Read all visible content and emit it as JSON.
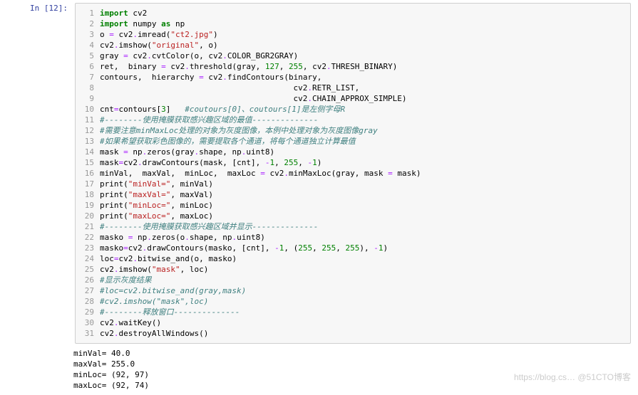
{
  "cell": {
    "prompt": "In [12]:",
    "lines": [
      {
        "n": "1",
        "html": "<span class='kw'>import</span> <span class='nam'>cv2</span>"
      },
      {
        "n": "2",
        "html": "<span class='kw'>import</span> <span class='nam'>numpy</span> <span class='kw'>as</span> <span class='nam'>np</span>"
      },
      {
        "n": "3",
        "html": "<span class='nam'>o</span> <span class='op'>=</span> <span class='nam'>cv2</span><span class='op'>.</span><span class='nam'>imread</span>(<span class='str'>\"ct2.jpg\"</span>)"
      },
      {
        "n": "4",
        "html": "<span class='nam'>cv2</span><span class='op'>.</span><span class='nam'>imshow</span>(<span class='str'>\"original\"</span>, <span class='nam'>o</span>)"
      },
      {
        "n": "5",
        "html": "<span class='nam'>gray</span> <span class='op'>=</span> <span class='nam'>cv2</span><span class='op'>.</span><span class='nam'>cvtColor</span>(<span class='nam'>o</span>, <span class='nam'>cv2</span><span class='op'>.</span><span class='nam'>COLOR_BGR2GRAY</span>)"
      },
      {
        "n": "6",
        "html": "<span class='nam'>ret</span>,  <span class='nam'>binary</span> <span class='op'>=</span> <span class='nam'>cv2</span><span class='op'>.</span><span class='nam'>threshold</span>(<span class='nam'>gray</span>, <span class='num'>127</span>, <span class='num'>255</span>, <span class='nam'>cv2</span><span class='op'>.</span><span class='nam'>THRESH_BINARY</span>)"
      },
      {
        "n": "7",
        "html": "<span class='nam'>contours</span>,  <span class='nam'>hierarchy</span> <span class='op'>=</span> <span class='nam'>cv2</span><span class='op'>.</span><span class='nam'>findContours</span>(<span class='nam'>binary</span>,"
      },
      {
        "n": "8",
        "html": "                                         <span class='nam'>cv2</span><span class='op'>.</span><span class='nam'>RETR_LIST</span>,"
      },
      {
        "n": "9",
        "html": "                                         <span class='nam'>cv2</span><span class='op'>.</span><span class='nam'>CHAIN_APPROX_SIMPLE</span>)"
      },
      {
        "n": "10",
        "html": "<span class='nam'>cnt</span><span class='op'>=</span><span class='nam'>contours</span>[<span class='num'>3</span>]   <span class='cmt'>#coutours[0]、coutours[1]是左侧字母R</span>"
      },
      {
        "n": "11",
        "html": "<span class='cmt'>#--------使用掩膜获取感兴趣区域的最值--------------</span>"
      },
      {
        "n": "12",
        "html": "<span class='cmt'>#需要注意minMaxLoc处理的对象为灰度图像，本例中处理对象为灰度图像gray</span>"
      },
      {
        "n": "13",
        "html": "<span class='cmt'>#如果希望获取彩色图像的，需要提取各个通道，将每个通道独立计算最值</span>"
      },
      {
        "n": "14",
        "html": "<span class='nam'>mask</span> <span class='op'>=</span> <span class='nam'>np</span><span class='op'>.</span><span class='nam'>zeros</span>(<span class='nam'>gray</span><span class='op'>.</span><span class='nam'>shape</span>, <span class='nam'>np</span><span class='op'>.</span><span class='nam'>uint8</span>)"
      },
      {
        "n": "15",
        "html": "<span class='nam'>mask</span><span class='op'>=</span><span class='nam'>cv2</span><span class='op'>.</span><span class='nam'>drawContours</span>(<span class='nam'>mask</span>, [<span class='nam'>cnt</span>], <span class='op'>-</span><span class='num'>1</span>, <span class='num'>255</span>, <span class='op'>-</span><span class='num'>1</span>)"
      },
      {
        "n": "16",
        "html": "<span class='nam'>minVal</span>,  <span class='nam'>maxVal</span>,  <span class='nam'>minLoc</span>,  <span class='nam'>maxLoc</span> <span class='op'>=</span> <span class='nam'>cv2</span><span class='op'>.</span><span class='nam'>minMaxLoc</span>(<span class='nam'>gray</span>, <span class='nam'>mask</span> <span class='op'>=</span> <span class='nam'>mask</span>)"
      },
      {
        "n": "17",
        "html": "<span class='fn'>print</span>(<span class='str'>\"minVal=\"</span>, <span class='nam'>minVal</span>)"
      },
      {
        "n": "18",
        "html": "<span class='fn'>print</span>(<span class='str'>\"maxVal=\"</span>, <span class='nam'>maxVal</span>)"
      },
      {
        "n": "19",
        "html": "<span class='fn'>print</span>(<span class='str'>\"minLoc=\"</span>, <span class='nam'>minLoc</span>)"
      },
      {
        "n": "20",
        "html": "<span class='fn'>print</span>(<span class='str'>\"maxLoc=\"</span>, <span class='nam'>maxLoc</span>)"
      },
      {
        "n": "21",
        "html": "<span class='cmt'>#--------使用掩膜获取感兴趣区域并显示--------------</span>"
      },
      {
        "n": "22",
        "html": "<span class='nam'>masko</span> <span class='op'>=</span> <span class='nam'>np</span><span class='op'>.</span><span class='nam'>zeros</span>(<span class='nam'>o</span><span class='op'>.</span><span class='nam'>shape</span>, <span class='nam'>np</span><span class='op'>.</span><span class='nam'>uint8</span>)"
      },
      {
        "n": "23",
        "html": "<span class='nam'>masko</span><span class='op'>=</span><span class='nam'>cv2</span><span class='op'>.</span><span class='nam'>drawContours</span>(<span class='nam'>masko</span>, [<span class='nam'>cnt</span>], <span class='op'>-</span><span class='num'>1</span>, (<span class='num'>255</span>, <span class='num'>255</span>, <span class='num'>255</span>), <span class='op'>-</span><span class='num'>1</span>)"
      },
      {
        "n": "24",
        "html": "<span class='nam'>loc</span><span class='op'>=</span><span class='nam'>cv2</span><span class='op'>.</span><span class='nam'>bitwise_and</span>(<span class='nam'>o</span>, <span class='nam'>masko</span>)"
      },
      {
        "n": "25",
        "html": "<span class='nam'>cv2</span><span class='op'>.</span><span class='nam'>imshow</span>(<span class='str'>\"mask\"</span>, <span class='nam'>loc</span>)"
      },
      {
        "n": "26",
        "html": "<span class='cmt'>#显示灰度结果</span>"
      },
      {
        "n": "27",
        "html": "<span class='cmt'>#loc=cv2.bitwise_and(gray,mask)</span>"
      },
      {
        "n": "28",
        "html": "<span class='cmt'>#cv2.imshow(\"mask\",loc)</span>"
      },
      {
        "n": "29",
        "html": "<span class='cmt'>#--------释放窗口--------------</span>"
      },
      {
        "n": "30",
        "html": "<span class='nam'>cv2</span><span class='op'>.</span><span class='nam'>waitKey</span>()"
      },
      {
        "n": "31",
        "html": "<span class='nam'>cv2</span><span class='op'>.</span><span class='nam'>destroyAllWindows</span>()"
      }
    ]
  },
  "output": [
    "minVal= 40.0",
    "maxVal= 255.0",
    "minLoc= (92, 97)",
    "maxLoc= (92, 74)"
  ],
  "watermark": "https://blog.cs… @51CTO博客"
}
